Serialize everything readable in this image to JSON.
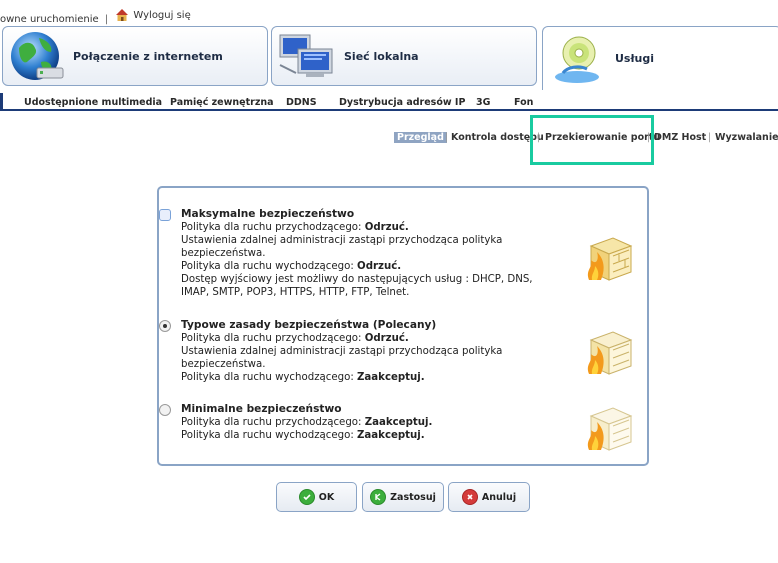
{
  "topbar": {
    "restart_label": "owne uruchomienie",
    "separator": "|",
    "logout_label": "Wyloguj się"
  },
  "main_tabs": [
    {
      "label": "Połączenie z internetem",
      "icon": "globe-icon"
    },
    {
      "label": "Sieć lokalna",
      "icon": "lan-computers-icon"
    },
    {
      "label": "Usługi",
      "icon": "services-disc-icon"
    }
  ],
  "subnav": [
    "Udostępnione multimedia",
    "Pamięć zewnętrzna",
    "DDNS",
    "Dystrybucja adresów IP",
    "3G",
    "Fon"
  ],
  "path_nav": {
    "items": [
      "Przegląd",
      "Kontrola dostępu",
      "Przekierowanie portu",
      "DMZ Host",
      "Wyzwalanie p"
    ],
    "separator": "|"
  },
  "security": {
    "max": {
      "title": "Maksymalne bezpieczeństwo",
      "in_prefix": "Polityka dla ruchu przychodzącego: ",
      "in_value": "Odrzuć.",
      "admin_note": "Ustawienia zdalnej administracji zastąpi przychodząca polityka bezpieczeństwa.",
      "out_prefix": "Polityka dla ruchu wychodzącego: ",
      "out_value": "Odrzuć.",
      "services_note": "Dostęp wyjściowy jest możliwy do następujących usług : DHCP, DNS, IMAP, SMTP, POP3, HTTPS, HTTP, FTP, Telnet."
    },
    "typical": {
      "title": "Typowe zasady bezpieczeństwa (Polecany)",
      "in_prefix": "Polityka dla ruchu przychodzącego: ",
      "in_value": "Odrzuć.",
      "admin_note": "Ustawienia zdalnej administracji zastąpi przychodząca polityka bezpieczeństwa.",
      "out_prefix": "Polityka dla ruchu wychodzącego: ",
      "out_value": "Zaakceptuj."
    },
    "min": {
      "title": "Minimalne bezpieczeństwo",
      "in_prefix": "Polityka dla ruchu przychodzącego: ",
      "in_value": "Zaakceptuj.",
      "out_prefix": "Polityka dla ruchu wychodzącego: ",
      "out_value": "Zaakceptuj."
    },
    "selected": "typical"
  },
  "buttons": {
    "ok": "OK",
    "apply": "Zastosuj",
    "cancel": "Anuluj"
  },
  "colors": {
    "nav_dark": "#1d3b78",
    "border": "#8aa4c6",
    "highlight": "#19cba0",
    "active_path": "#8fa4c2"
  }
}
